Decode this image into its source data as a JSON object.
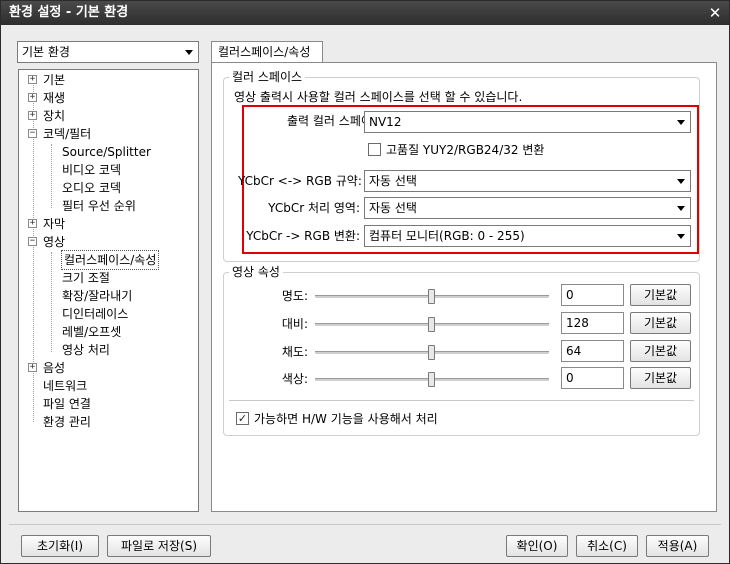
{
  "window": {
    "title": "환경 설정 - 기본 환경",
    "close_glyph": "✕"
  },
  "category_select": {
    "value": "기본 환경"
  },
  "tree": {
    "items": [
      {
        "label": "기본",
        "expander": "+"
      },
      {
        "label": "재생",
        "expander": "+"
      },
      {
        "label": "장치",
        "expander": "+"
      },
      {
        "label": "코덱/필터",
        "expander": "−"
      },
      {
        "label": "Source/Splitter"
      },
      {
        "label": "비디오 코덱"
      },
      {
        "label": "오디오 코덱"
      },
      {
        "label": "필터 우선 순위"
      },
      {
        "label": "자막",
        "expander": "+"
      },
      {
        "label": "영상",
        "expander": "−"
      },
      {
        "label": "컬러스페이스/속성",
        "selected": true
      },
      {
        "label": "크기 조절"
      },
      {
        "label": "확장/잘라내기"
      },
      {
        "label": "디인터레이스"
      },
      {
        "label": "레벨/오프셋"
      },
      {
        "label": "영상 처리"
      },
      {
        "label": "음성",
        "expander": "+"
      },
      {
        "label": "네트워크"
      },
      {
        "label": "파일 연결"
      },
      {
        "label": "환경 관리"
      }
    ]
  },
  "tab": {
    "label": "컬러스페이스/속성"
  },
  "colorspace": {
    "title": "컬러 스페이스",
    "description": "영상 출력시 사용할 컬러 스페이스를 선택 할 수 있습니다.",
    "output_label": "출력 컬러 스페이스:",
    "output_value": "NV12",
    "hq_checkbox_label": "고품질 YUY2/RGB24/32 변환",
    "hq_checked": false,
    "rule_label": "YCbCr <-> RGB 규약:",
    "rule_value": "자동 선택",
    "range_label": "YCbCr 처리 영역:",
    "range_value": "자동 선택",
    "conv_label": "YCbCr -> RGB 변환:",
    "conv_value": "컴퓨터 모니터(RGB: 0 - 255)",
    "highlight_color": "#e00000"
  },
  "properties": {
    "title": "영상 속성",
    "rows": [
      {
        "label": "명도:",
        "value": "0",
        "level": 0.5,
        "reset": "기본값"
      },
      {
        "label": "대비:",
        "value": "128",
        "level": 0.5,
        "reset": "기본값"
      },
      {
        "label": "채도:",
        "value": "64",
        "level": 0.5,
        "reset": "기본값"
      },
      {
        "label": "색상:",
        "value": "0",
        "level": 0.5,
        "reset": "기본값"
      }
    ],
    "hw_checkbox_label": "가능하면 H/W 기능을 사용해서 처리",
    "hw_checked": true,
    "check_glyph": "✓"
  },
  "buttons": {
    "reset": "초기화(I)",
    "save_file": "파일로 저장(S)",
    "ok": "확인(O)",
    "cancel": "취소(C)",
    "apply": "적용(A)"
  }
}
